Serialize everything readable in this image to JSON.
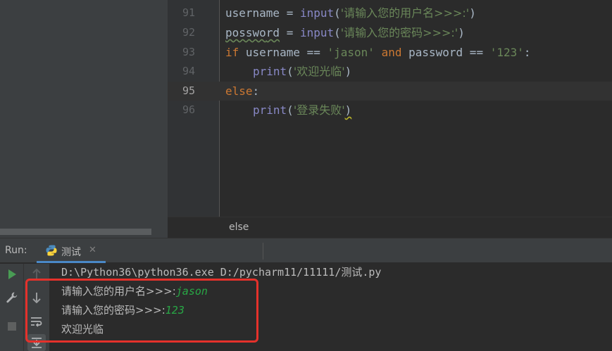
{
  "editor": {
    "lines": [
      {
        "num": "91",
        "active": false
      },
      {
        "num": "92",
        "active": false
      },
      {
        "num": "93",
        "active": false
      },
      {
        "num": "94",
        "active": false
      },
      {
        "num": "95",
        "active": true
      },
      {
        "num": "96",
        "active": false
      }
    ],
    "code": {
      "l91": {
        "var": "username",
        "op": " = ",
        "fn": "input",
        "p1": "(",
        "str": "'请输入您的用户名>>>:'",
        "p2": ")"
      },
      "l92": {
        "var": "posswo",
        "var_typo": "rd",
        "op": " = ",
        "fn": "input",
        "p1": "(",
        "str": "'请输入您的密码>>>:'",
        "p2": ")"
      },
      "l93": {
        "kw_if": "if",
        "a": " username == ",
        "s1": "'jason'",
        "kw_and": " and ",
        "b": "password == ",
        "s2": "'123'",
        "colon": ":"
      },
      "l94": {
        "fn": "print",
        "p1": "(",
        "str": "'欢迎光临'",
        "p2": ")"
      },
      "l95": {
        "kw_else": "else",
        "colon": ":"
      },
      "l96": {
        "fn": "print",
        "p1": "(",
        "str": "'登录失败'",
        "p2": ")"
      }
    },
    "breadcrumb": "else"
  },
  "run": {
    "label": "Run:",
    "tab_label": "测试",
    "tab_close": "✕",
    "console": {
      "command": "D:\\Python36\\python36.exe D:/pycharm11/11111/测试.py",
      "prompt1": "请输入您的用户名>>>:",
      "input1": "jason",
      "prompt2": "请输入您的密码>>>:",
      "input2": "123",
      "output": "欢迎光临"
    }
  },
  "colors": {
    "keyword": "#cc7832",
    "builtin": "#8888c6",
    "string": "#6a8759",
    "user_input": "#28a745",
    "highlight_box": "#e5312b",
    "tab_underline": "#4a88c7"
  }
}
